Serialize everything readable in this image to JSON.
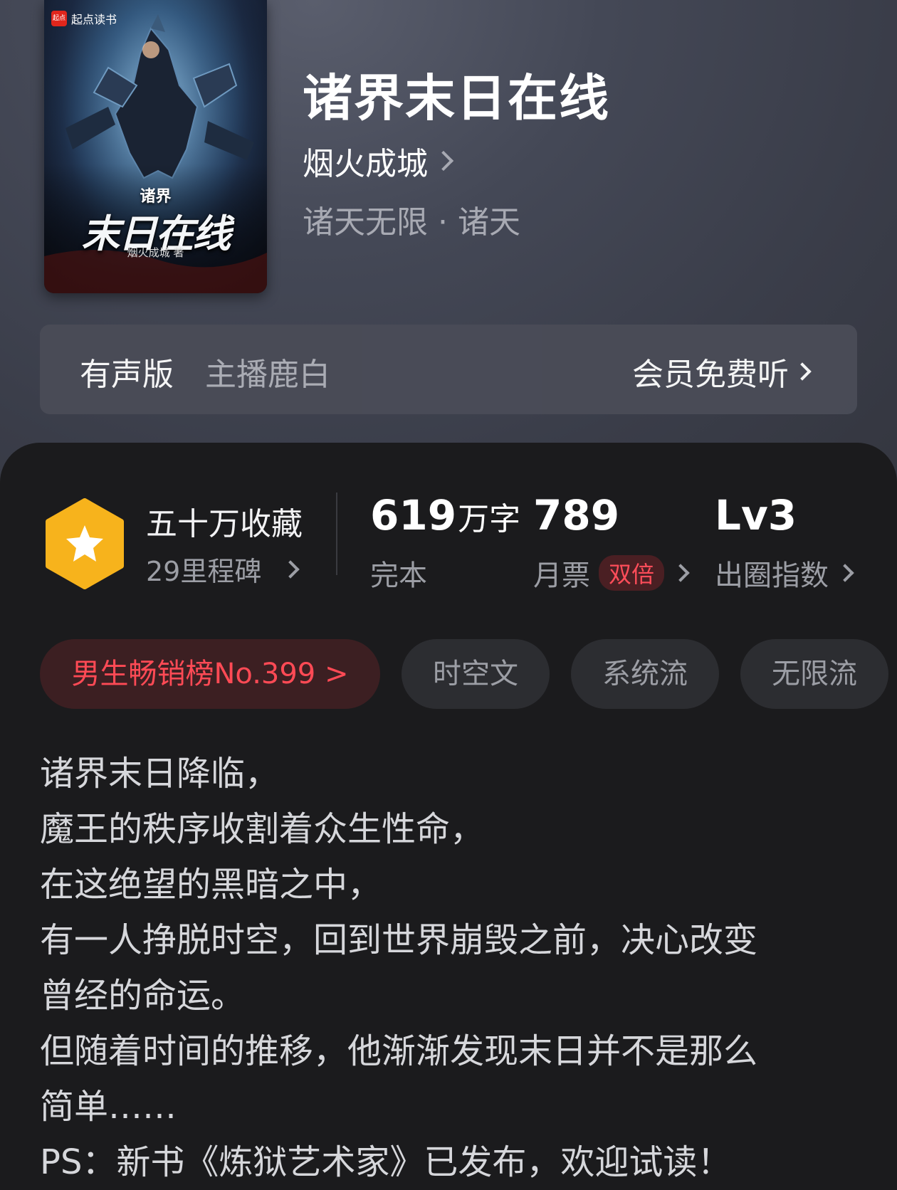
{
  "cover": {
    "brand": "起点读书",
    "brand_logo": "起点",
    "small_title": "诸界",
    "big_title": "末日在线",
    "author_line": "烟火成城 著"
  },
  "book": {
    "title": "诸界末日在线",
    "author": "烟火成城",
    "genre": "诸天无限 · 诸天"
  },
  "audio": {
    "label": "有声版",
    "host": "主播鹿白",
    "cta": "会员免费听"
  },
  "stats": {
    "favorites_label": "五十万收藏",
    "milestones": "29里程碑",
    "word_count": "619",
    "word_unit": "万字",
    "status": "完本",
    "monthly_votes": "789",
    "monthly_votes_label": "月票",
    "double_badge": "双倍",
    "level": "Lv3",
    "level_label": "出圈指数"
  },
  "tags": [
    "男生畅销榜No.399 >",
    "时空文",
    "系统流",
    "无限流"
  ],
  "synopsis": [
    "诸界末日降临，",
    "魔王的秩序收割着众生性命，",
    "在这绝望的黑暗之中，",
    "有一人挣脱时空，回到世界崩毁之前，决心改变",
    "曾经的命运。",
    "但随着时间的推移，他渐渐发现末日并不是那么",
    "简单……",
    "PS：新书《炼狱艺术家》已发布，欢迎试读！"
  ],
  "colors": {
    "accent_red": "#ff4a55",
    "badge_gold": "#f7b31c"
  }
}
